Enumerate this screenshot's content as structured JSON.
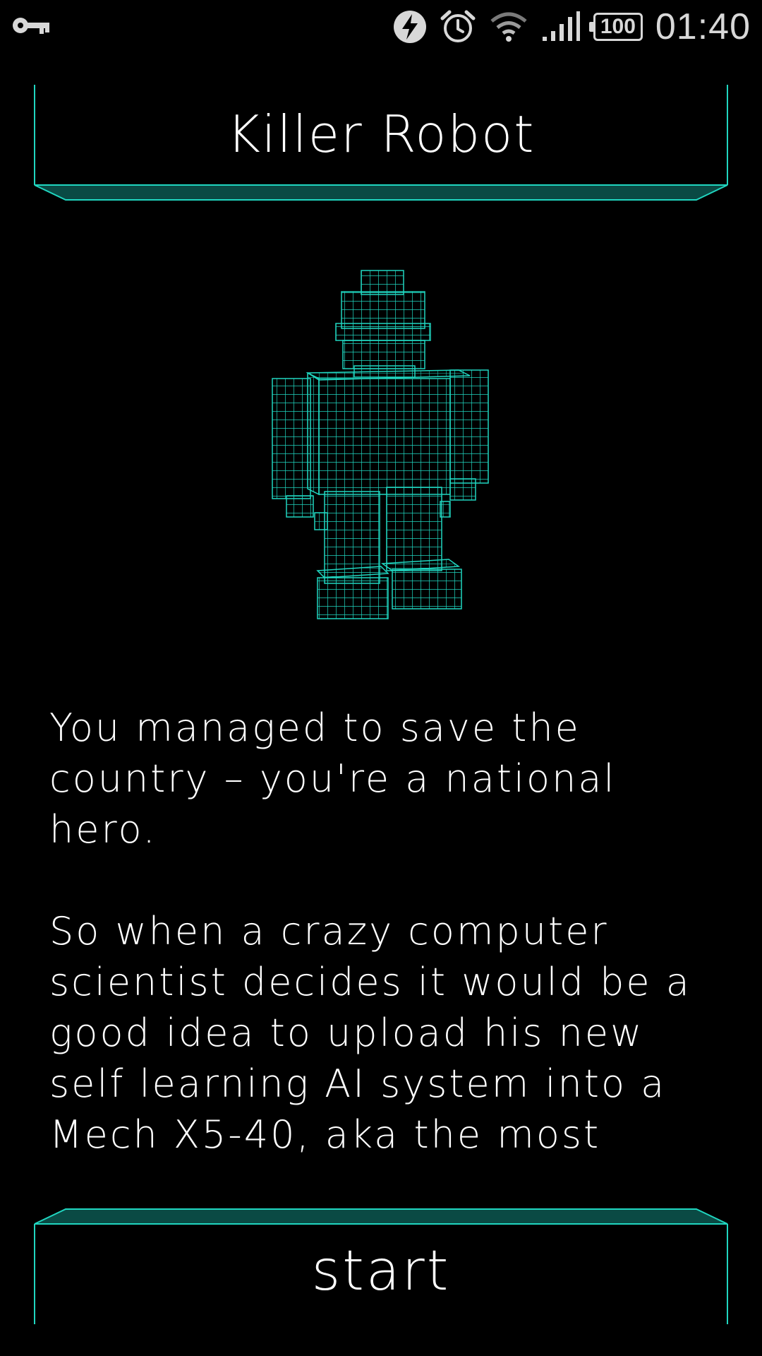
{
  "status_bar": {
    "battery": "100",
    "time": "01:40",
    "icons": [
      "key-icon",
      "flash-icon",
      "alarm-icon",
      "wifi-icon",
      "signal-icon",
      "battery-icon"
    ]
  },
  "header": {
    "title": "Killer Robot"
  },
  "story": {
    "text": "You managed to save the country – you're a national hero.\n\nSo when a crazy computer scientist decides it would be a good idea to upload his new self learning AI system into a Mech X5-40, aka the most"
  },
  "actions": {
    "start_label": "start"
  },
  "colors": {
    "accent": "#20d6c0",
    "accent_dark": "#0a4a44",
    "background": "#000000"
  }
}
